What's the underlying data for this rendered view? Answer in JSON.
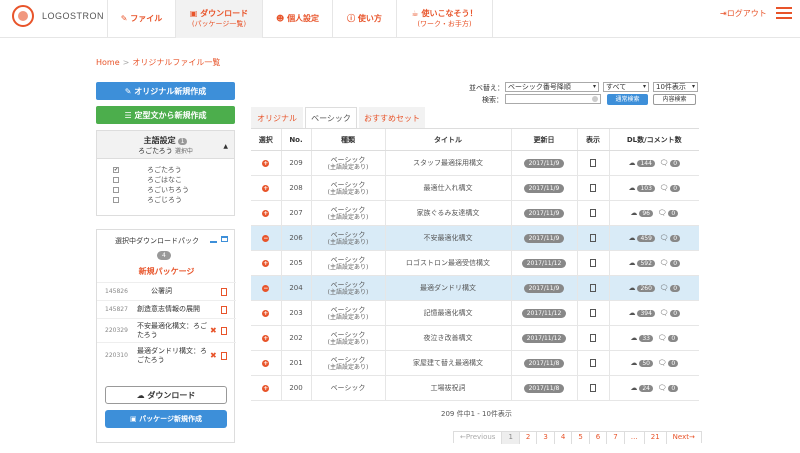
{
  "header": {
    "logo_text": "LOGOSTRON",
    "nav": [
      {
        "label": "ファイル",
        "sub": "",
        "icon": "edit-icon"
      },
      {
        "label": "ダウンロード",
        "sub": "(パッケージ一覧)",
        "icon": "briefcase-icon"
      },
      {
        "label": "個人設定",
        "sub": "",
        "icon": "users-icon"
      },
      {
        "label": "使い方",
        "sub": "",
        "icon": "info-icon"
      },
      {
        "label": "使いこなそう！",
        "sub": "(ワーク・お手方)",
        "icon": "coffee-icon"
      }
    ],
    "logout": "ログアウト"
  },
  "breadcrumb": {
    "home": "Home",
    "separator": ">",
    "current": "オリジナルファイル一覧"
  },
  "left": {
    "new_original": "オリジナル新規作成",
    "new_from_template": "定型文から新規作成",
    "subject": {
      "title": "主語設定",
      "count": "1",
      "current_user": "ろごたろう",
      "current_note": "選択中",
      "options": [
        {
          "label": "ろごたろう",
          "checked": "✔"
        },
        {
          "label": "ろごはなこ",
          "checked": ""
        },
        {
          "label": "ろごいちろう",
          "checked": ""
        },
        {
          "label": "ろごじろう",
          "checked": ""
        }
      ]
    },
    "package": {
      "title": "選択中ダウンロードパック",
      "count": "4",
      "new_label": "新規パッケージ",
      "items": [
        {
          "id": "145826",
          "name": "公署詞",
          "removable": ""
        },
        {
          "id": "145827",
          "name": "創造意志情報の展開",
          "removable": ""
        },
        {
          "id": "220329",
          "name": "不安最適化構文：ろごたろう",
          "removable": "✖"
        },
        {
          "id": "220310",
          "name": "最適ダンドリ構文：ろごたろう",
          "removable": "✖"
        }
      ],
      "download_button": "ダウンロード",
      "create_button": "パッケージ新規作成"
    }
  },
  "controls": {
    "sort_label": "並べ替え：",
    "sort_value": "ベーシック番号降順",
    "filter_value": "すべて",
    "perpage_value": "10件表示",
    "search_label": "検索：",
    "search_placeholder": "",
    "search_button": "通常検索",
    "content_search_button": "内容検索"
  },
  "tabs": [
    "オリジナル",
    "ベーシック",
    "おすすめセット"
  ],
  "table": {
    "headers": [
      "選択",
      "No.",
      "種類",
      "タイトル",
      "更新日",
      "表示",
      "DL数/コメント数"
    ],
    "rows": [
      {
        "icon": "+",
        "no": "209",
        "type": "ベーシック",
        "type_sub": "(主語設定あり)",
        "title": "スタッフ最適採用構文",
        "date": "2017/11/9",
        "dl": "144",
        "comments": "0",
        "highlight": false
      },
      {
        "icon": "+",
        "no": "208",
        "type": "ベーシック",
        "type_sub": "(主語設定あり)",
        "title": "最適仕入れ構文",
        "date": "2017/11/9",
        "dl": "103",
        "comments": "0",
        "highlight": false
      },
      {
        "icon": "+",
        "no": "207",
        "type": "ベーシック",
        "type_sub": "(主語設定あり)",
        "title": "家族ぐるみ友達構文",
        "date": "2017/11/9",
        "dl": "96",
        "comments": "0",
        "highlight": false
      },
      {
        "icon": "−",
        "no": "206",
        "type": "ベーシック",
        "type_sub": "(主語設定あり)",
        "title": "不安最適化構文",
        "date": "2017/11/9",
        "dl": "459",
        "comments": "0",
        "highlight": true
      },
      {
        "icon": "+",
        "no": "205",
        "type": "ベーシック",
        "type_sub": "(主語設定あり)",
        "title": "ロゴストロン最適受信構文",
        "date": "2017/11/12",
        "dl": "592",
        "comments": "0",
        "highlight": false
      },
      {
        "icon": "−",
        "no": "204",
        "type": "ベーシック",
        "type_sub": "(主語設定あり)",
        "title": "最適ダンドリ構文",
        "date": "2017/11/9",
        "dl": "260",
        "comments": "0",
        "highlight": true
      },
      {
        "icon": "+",
        "no": "203",
        "type": "ベーシック",
        "type_sub": "(主語設定あり)",
        "title": "記憶最適化構文",
        "date": "2017/11/12",
        "dl": "394",
        "comments": "0",
        "highlight": false
      },
      {
        "icon": "+",
        "no": "202",
        "type": "ベーシック",
        "type_sub": "(主語設定あり)",
        "title": "夜泣き改善構文",
        "date": "2017/11/12",
        "dl": "33",
        "comments": "0",
        "highlight": false
      },
      {
        "icon": "+",
        "no": "201",
        "type": "ベーシック",
        "type_sub": "(主語設定あり)",
        "title": "家屋建て替え最適構文",
        "date": "2017/11/8",
        "dl": "50",
        "comments": "0",
        "highlight": false
      },
      {
        "icon": "+",
        "no": "200",
        "type": "ベーシック",
        "type_sub": "",
        "title": "工場祓祝詞",
        "date": "2017/11/8",
        "dl": "24",
        "comments": "0",
        "highlight": false
      }
    ]
  },
  "summary": "209 件中1 - 10件表示",
  "pager": [
    "←Previous",
    "1",
    "2",
    "3",
    "4",
    "5",
    "6",
    "7",
    "…",
    "21",
    "Next→"
  ],
  "colors": {
    "accent": "#e8542a",
    "blue": "#3d8fd9",
    "green": "#4cae4c",
    "highlight": "#d9ebf7"
  }
}
